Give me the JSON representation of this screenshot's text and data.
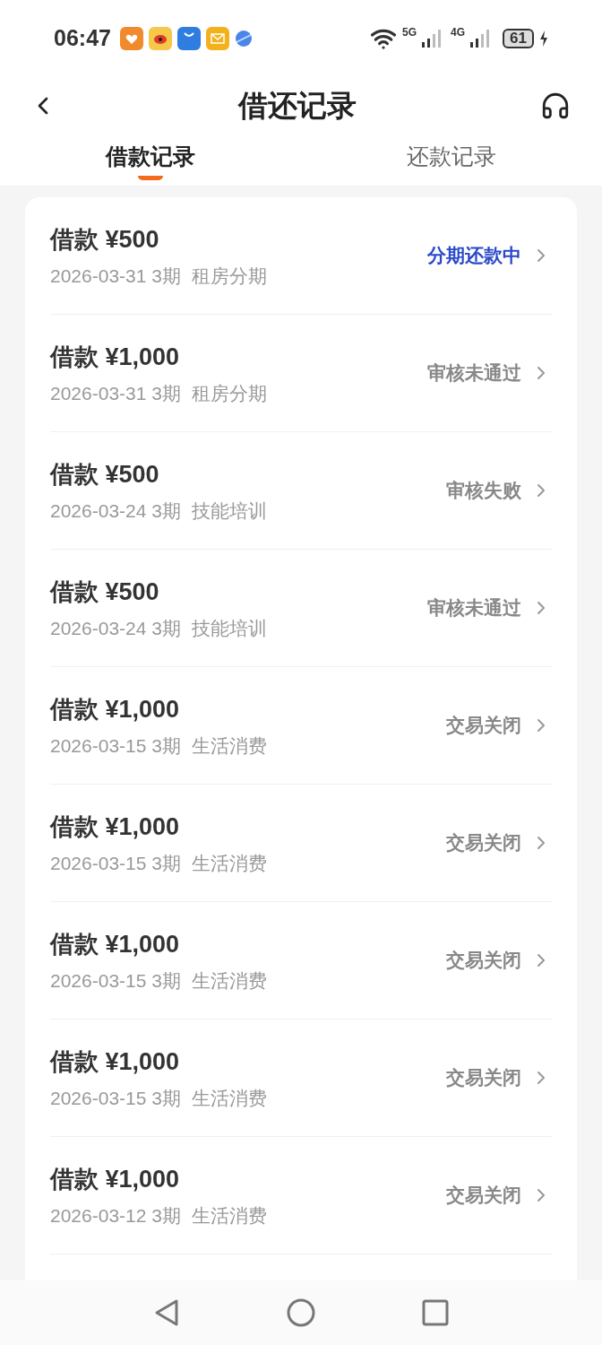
{
  "status_bar": {
    "time": "06:47",
    "network_1": "5G",
    "network_2": "4G",
    "battery": "61"
  },
  "header": {
    "title": "借还记录"
  },
  "tabs": [
    {
      "label": "借款记录",
      "selected": true
    },
    {
      "label": "还款记录",
      "selected": false
    }
  ],
  "records": [
    {
      "title": "借款 ¥500",
      "meta": "2026-03-31 3期  租房分期",
      "status": "分期还款中",
      "active": true
    },
    {
      "title": "借款 ¥1,000",
      "meta": "2026-03-31 3期  租房分期",
      "status": "审核未通过",
      "active": false
    },
    {
      "title": "借款 ¥500",
      "meta": "2026-03-24 3期  技能培训",
      "status": "审核失败",
      "active": false
    },
    {
      "title": "借款 ¥500",
      "meta": "2026-03-24 3期  技能培训",
      "status": "审核未通过",
      "active": false
    },
    {
      "title": "借款 ¥1,000",
      "meta": "2026-03-15 3期  生活消费",
      "status": "交易关闭",
      "active": false
    },
    {
      "title": "借款 ¥1,000",
      "meta": "2026-03-15 3期  生活消费",
      "status": "交易关闭",
      "active": false
    },
    {
      "title": "借款 ¥1,000",
      "meta": "2026-03-15 3期  生活消费",
      "status": "交易关闭",
      "active": false
    },
    {
      "title": "借款 ¥1,000",
      "meta": "2026-03-15 3期  生活消费",
      "status": "交易关闭",
      "active": false
    },
    {
      "title": "借款 ¥1,000",
      "meta": "2026-03-12 3期  生活消费",
      "status": "交易关闭",
      "active": false
    }
  ]
}
